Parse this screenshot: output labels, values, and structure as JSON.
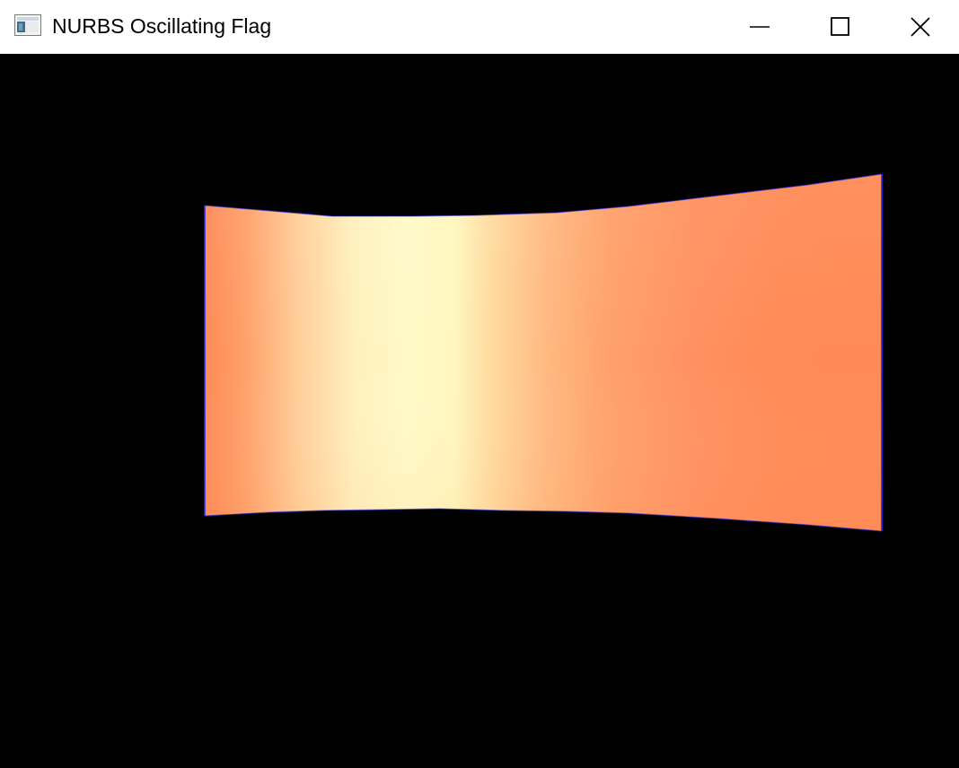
{
  "window": {
    "title": "NURBS Oscillating Flag",
    "icon": "application-window-icon",
    "controls": {
      "minimize_icon": "minimize-icon",
      "maximize_icon": "maximize-icon",
      "close_icon": "close-icon"
    }
  },
  "scene": {
    "background_color": "#000000",
    "surface": "nurbs-flag-surface",
    "edge_color": "#2a2aff",
    "shading_colors": {
      "edge_orange": "#ff8a55",
      "highlight_yellow": "#fffac8",
      "mid_peach": "#ffb27a"
    }
  }
}
